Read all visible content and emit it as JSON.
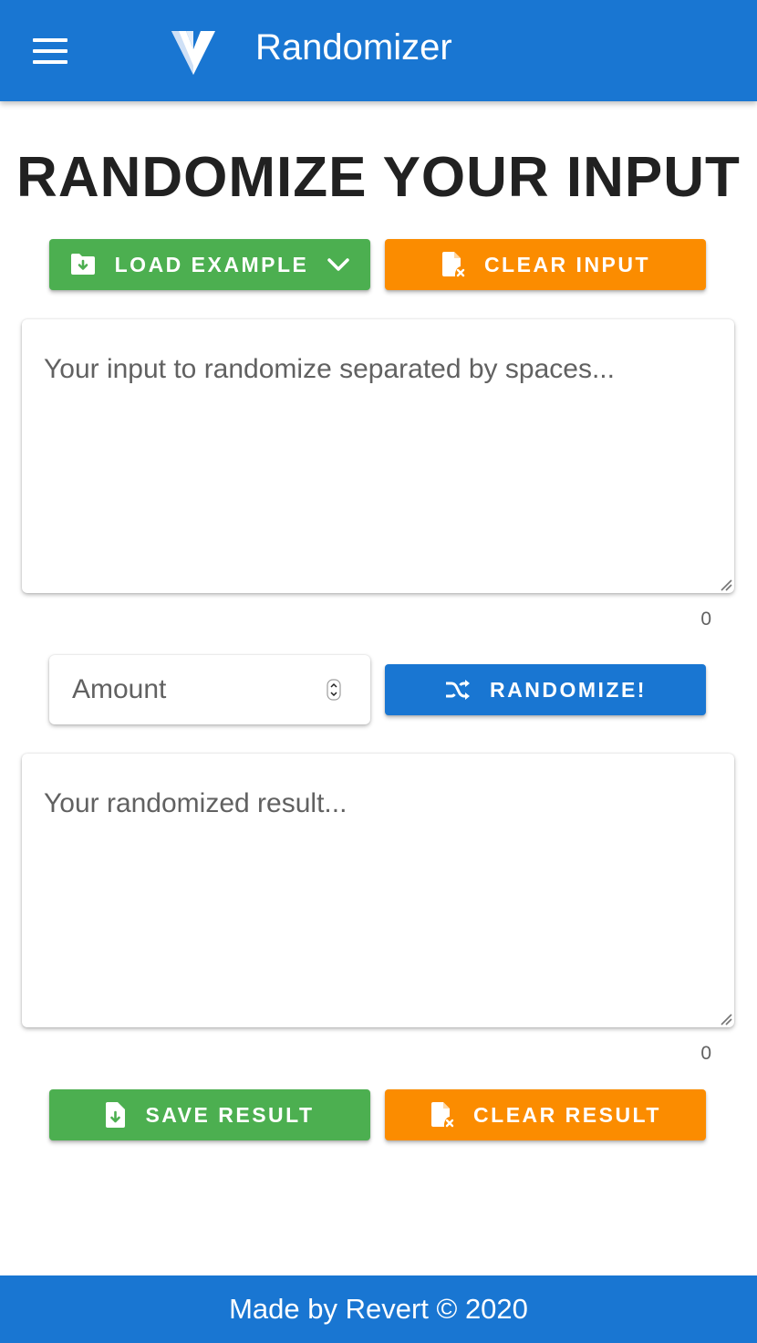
{
  "app_bar": {
    "title": "Randomizer",
    "menu_icon": "hamburger-menu-icon",
    "logo_icon": "vuetify-logo-icon"
  },
  "main": {
    "heading": "RANDOMIZE YOUR INPUT",
    "load_example_label": "LOAD EXAMPLE",
    "clear_input_label": "CLEAR INPUT",
    "input": {
      "placeholder": "Your input to randomize separated by spaces...",
      "value": "",
      "counter": "0"
    },
    "amount": {
      "placeholder": "Amount",
      "value": ""
    },
    "randomize_label": "RANDOMIZE!",
    "result": {
      "placeholder": "Your randomized result...",
      "value": "",
      "counter": "0"
    },
    "save_result_label": "SAVE RESULT",
    "clear_result_label": "CLEAR RESULT"
  },
  "footer": {
    "text": "Made by Revert © 2020"
  },
  "colors": {
    "primary": "#1976d2",
    "success": "#4caf50",
    "warning": "#fb8c00"
  }
}
